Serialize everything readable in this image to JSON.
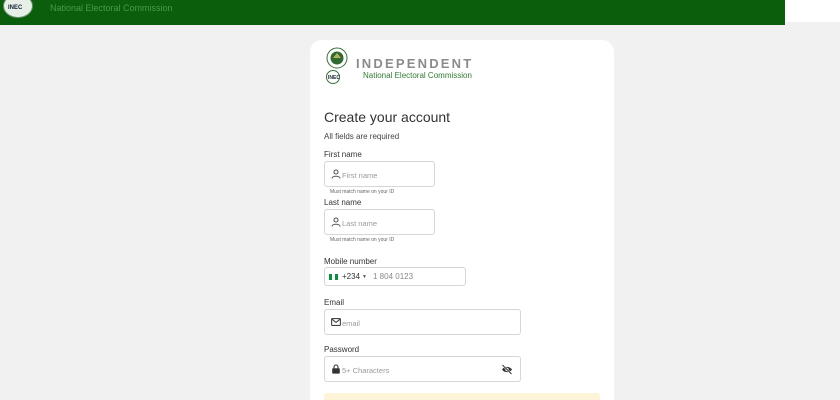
{
  "topbar": {
    "logo_text": "INEC",
    "title": "National Electoral Commission",
    "nav": [
      "",
      ""
    ]
  },
  "brand": {
    "main": "INDEPENDENT",
    "sub": "National Electoral Commission",
    "seal_text": "INEC"
  },
  "form": {
    "title": "Create your account",
    "subtitle": "All fields are required",
    "first_name": {
      "label": "First name",
      "placeholder": "First name",
      "hint": "Must match name on your ID",
      "icon": "user-icon"
    },
    "last_name": {
      "label": "Last name",
      "placeholder": "Last name",
      "hint": "Must match name on your ID",
      "icon": "user-icon"
    },
    "mobile": {
      "label": "Mobile number",
      "country_code": "+234",
      "placeholder": "1 804 0123",
      "flag_colors": [
        "#0a8f3d",
        "#ffffff",
        "#0a8f3d"
      ]
    },
    "email": {
      "label": "Email",
      "placeholder": "email",
      "icon": "envelope-icon"
    },
    "password": {
      "label": "Password",
      "placeholder": "5+ Characters",
      "icon": "lock-icon",
      "toggle_icon": "eye-off-icon"
    }
  },
  "colors": {
    "brand_green": "#0b5e0b",
    "notice_bg": "#fdf3d6"
  }
}
